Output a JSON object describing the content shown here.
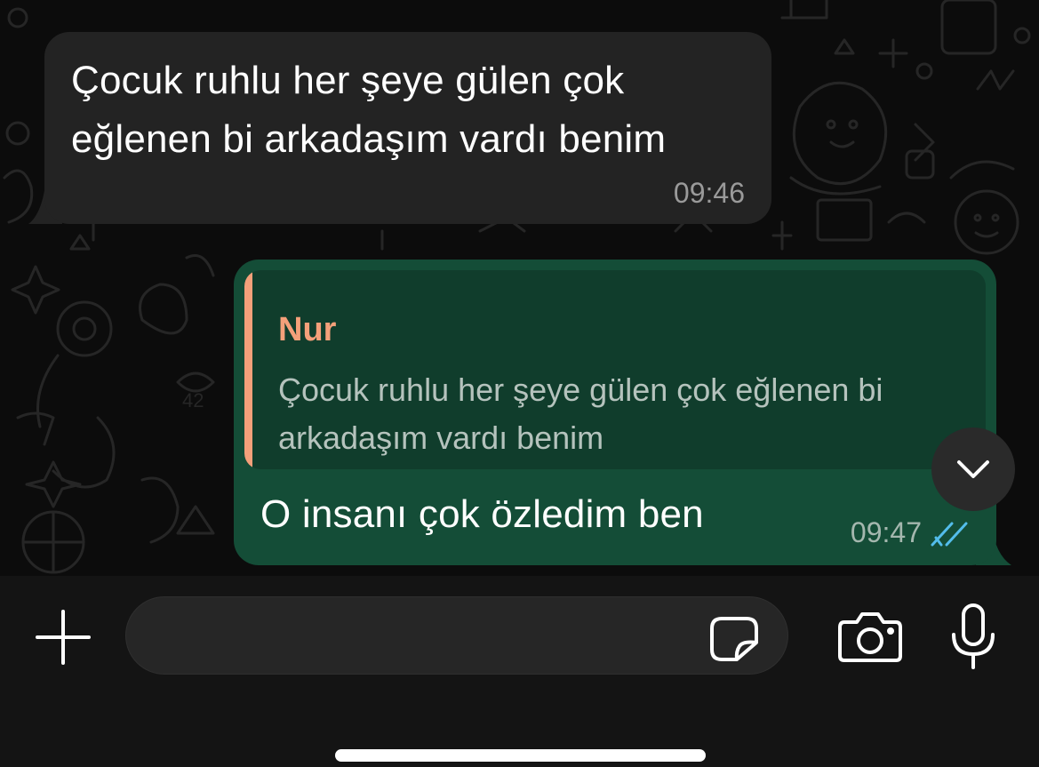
{
  "messages": {
    "incoming": {
      "text_line1": "Çocuk ruhlu her şeye gülen çok",
      "text_line2": "eğlenen bi arkadaşım vardı benim",
      "time": "09:46"
    },
    "outgoing": {
      "reply_to": {
        "author": "Nur",
        "text_line1": "Çocuk ruhlu her şeye gülen çok eğlenen bi",
        "text_line2": "arkadaşım vardı benim"
      },
      "text": "O insanı çok özledim ben",
      "time": "09:47",
      "status_icon": "double-check-read-icon"
    }
  },
  "composer": {
    "placeholder": "",
    "value": ""
  },
  "icons": {
    "attach": "plus-icon",
    "sticker": "sticker-icon",
    "camera": "camera-icon",
    "mic": "microphone-icon",
    "scroll_down": "chevron-down-icon"
  },
  "colors": {
    "incoming_bubble": "#232323",
    "outgoing_bubble": "#144d37",
    "quote_accent": "#f4a07a",
    "read_ticks": "#53bdeb"
  }
}
